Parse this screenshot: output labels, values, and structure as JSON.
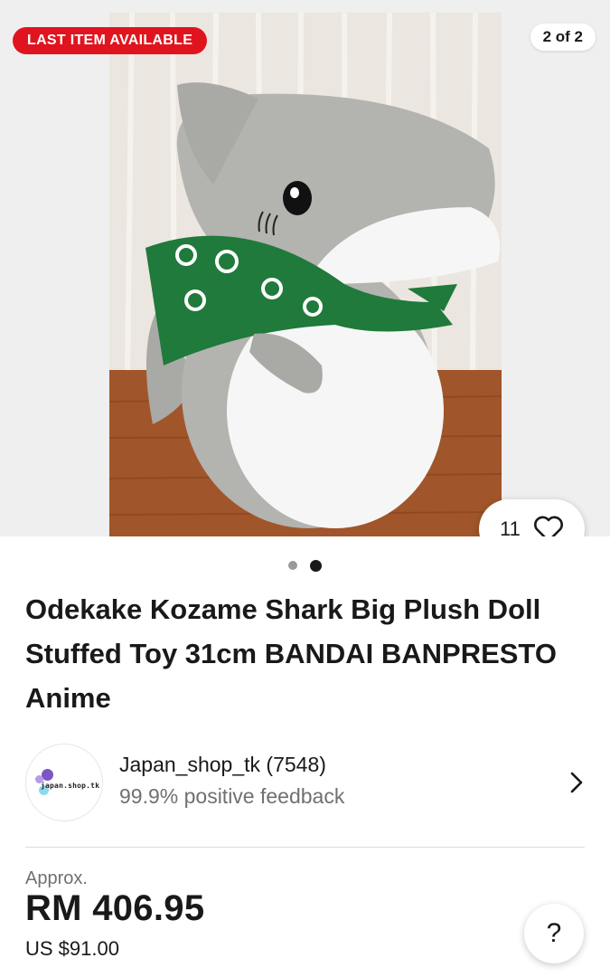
{
  "gallery": {
    "badge": "LAST ITEM AVAILABLE",
    "counter": "2 of 2",
    "watch_count": "11",
    "pager": {
      "total": 2,
      "active": 2
    }
  },
  "listing": {
    "title": "Odekake Kozame Shark Big Plush Doll Stuffed Toy 31cm BANDAI BANPRESTO Anime"
  },
  "seller": {
    "logo_text": "japan.shop.tk",
    "name": "Japan_shop_tk (7548)",
    "feedback": "99.9% positive feedback"
  },
  "price": {
    "approx_label": "Approx.",
    "primary": "RM 406.95",
    "secondary": "US $91.00"
  },
  "help": {
    "label": "?"
  },
  "colors": {
    "badge": "#e0141e",
    "text": "#191919",
    "muted": "#707070",
    "bandana": "#1f7a3b"
  },
  "icons": [
    "heart-icon",
    "chevron-right-icon",
    "help-icon"
  ]
}
